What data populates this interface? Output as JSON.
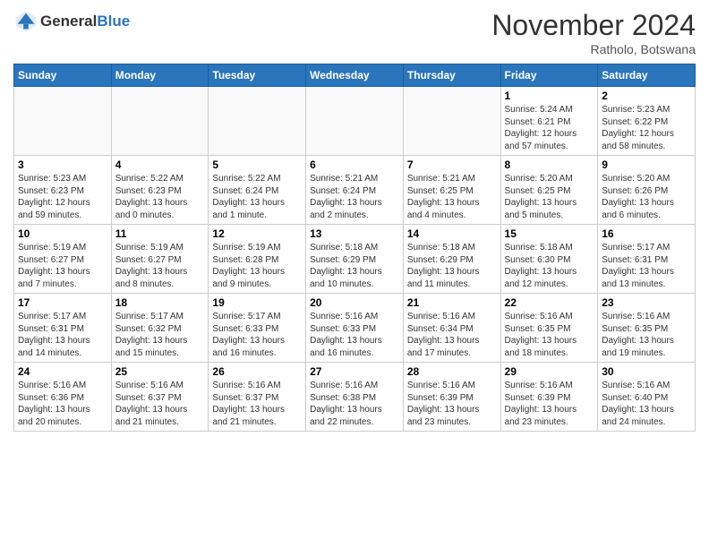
{
  "header": {
    "logo_general": "General",
    "logo_blue": "Blue",
    "month_title": "November 2024",
    "location": "Ratholo, Botswana"
  },
  "weekdays": [
    "Sunday",
    "Monday",
    "Tuesday",
    "Wednesday",
    "Thursday",
    "Friday",
    "Saturday"
  ],
  "weeks": [
    [
      {
        "day": "",
        "empty": true
      },
      {
        "day": "",
        "empty": true
      },
      {
        "day": "",
        "empty": true
      },
      {
        "day": "",
        "empty": true
      },
      {
        "day": "",
        "empty": true
      },
      {
        "day": "1",
        "info": "Sunrise: 5:24 AM\nSunset: 6:21 PM\nDaylight: 12 hours\nand 57 minutes."
      },
      {
        "day": "2",
        "info": "Sunrise: 5:23 AM\nSunset: 6:22 PM\nDaylight: 12 hours\nand 58 minutes."
      }
    ],
    [
      {
        "day": "3",
        "info": "Sunrise: 5:23 AM\nSunset: 6:23 PM\nDaylight: 12 hours\nand 59 minutes."
      },
      {
        "day": "4",
        "info": "Sunrise: 5:22 AM\nSunset: 6:23 PM\nDaylight: 13 hours\nand 0 minutes."
      },
      {
        "day": "5",
        "info": "Sunrise: 5:22 AM\nSunset: 6:24 PM\nDaylight: 13 hours\nand 1 minute."
      },
      {
        "day": "6",
        "info": "Sunrise: 5:21 AM\nSunset: 6:24 PM\nDaylight: 13 hours\nand 2 minutes."
      },
      {
        "day": "7",
        "info": "Sunrise: 5:21 AM\nSunset: 6:25 PM\nDaylight: 13 hours\nand 4 minutes."
      },
      {
        "day": "8",
        "info": "Sunrise: 5:20 AM\nSunset: 6:25 PM\nDaylight: 13 hours\nand 5 minutes."
      },
      {
        "day": "9",
        "info": "Sunrise: 5:20 AM\nSunset: 6:26 PM\nDaylight: 13 hours\nand 6 minutes."
      }
    ],
    [
      {
        "day": "10",
        "info": "Sunrise: 5:19 AM\nSunset: 6:27 PM\nDaylight: 13 hours\nand 7 minutes."
      },
      {
        "day": "11",
        "info": "Sunrise: 5:19 AM\nSunset: 6:27 PM\nDaylight: 13 hours\nand 8 minutes."
      },
      {
        "day": "12",
        "info": "Sunrise: 5:19 AM\nSunset: 6:28 PM\nDaylight: 13 hours\nand 9 minutes."
      },
      {
        "day": "13",
        "info": "Sunrise: 5:18 AM\nSunset: 6:29 PM\nDaylight: 13 hours\nand 10 minutes."
      },
      {
        "day": "14",
        "info": "Sunrise: 5:18 AM\nSunset: 6:29 PM\nDaylight: 13 hours\nand 11 minutes."
      },
      {
        "day": "15",
        "info": "Sunrise: 5:18 AM\nSunset: 6:30 PM\nDaylight: 13 hours\nand 12 minutes."
      },
      {
        "day": "16",
        "info": "Sunrise: 5:17 AM\nSunset: 6:31 PM\nDaylight: 13 hours\nand 13 minutes."
      }
    ],
    [
      {
        "day": "17",
        "info": "Sunrise: 5:17 AM\nSunset: 6:31 PM\nDaylight: 13 hours\nand 14 minutes."
      },
      {
        "day": "18",
        "info": "Sunrise: 5:17 AM\nSunset: 6:32 PM\nDaylight: 13 hours\nand 15 minutes."
      },
      {
        "day": "19",
        "info": "Sunrise: 5:17 AM\nSunset: 6:33 PM\nDaylight: 13 hours\nand 16 minutes."
      },
      {
        "day": "20",
        "info": "Sunrise: 5:16 AM\nSunset: 6:33 PM\nDaylight: 13 hours\nand 16 minutes."
      },
      {
        "day": "21",
        "info": "Sunrise: 5:16 AM\nSunset: 6:34 PM\nDaylight: 13 hours\nand 17 minutes."
      },
      {
        "day": "22",
        "info": "Sunrise: 5:16 AM\nSunset: 6:35 PM\nDaylight: 13 hours\nand 18 minutes."
      },
      {
        "day": "23",
        "info": "Sunrise: 5:16 AM\nSunset: 6:35 PM\nDaylight: 13 hours\nand 19 minutes."
      }
    ],
    [
      {
        "day": "24",
        "info": "Sunrise: 5:16 AM\nSunset: 6:36 PM\nDaylight: 13 hours\nand 20 minutes."
      },
      {
        "day": "25",
        "info": "Sunrise: 5:16 AM\nSunset: 6:37 PM\nDaylight: 13 hours\nand 21 minutes."
      },
      {
        "day": "26",
        "info": "Sunrise: 5:16 AM\nSunset: 6:37 PM\nDaylight: 13 hours\nand 21 minutes."
      },
      {
        "day": "27",
        "info": "Sunrise: 5:16 AM\nSunset: 6:38 PM\nDaylight: 13 hours\nand 22 minutes."
      },
      {
        "day": "28",
        "info": "Sunrise: 5:16 AM\nSunset: 6:39 PM\nDaylight: 13 hours\nand 23 minutes."
      },
      {
        "day": "29",
        "info": "Sunrise: 5:16 AM\nSunset: 6:39 PM\nDaylight: 13 hours\nand 23 minutes."
      },
      {
        "day": "30",
        "info": "Sunrise: 5:16 AM\nSunset: 6:40 PM\nDaylight: 13 hours\nand 24 minutes."
      }
    ]
  ]
}
